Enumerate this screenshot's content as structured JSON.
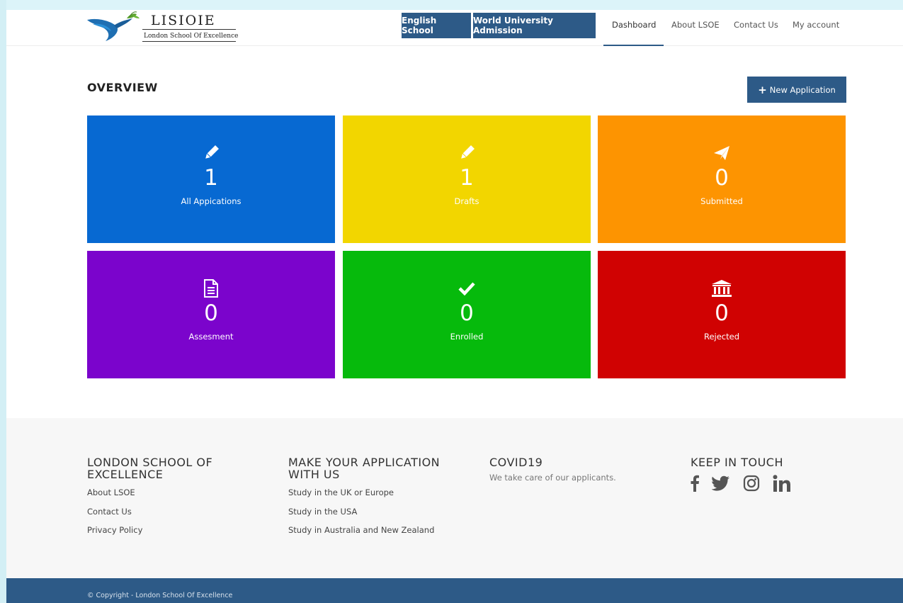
{
  "brand": {
    "name": "LISIOIE",
    "tagline": "London School Of Excellence"
  },
  "nav": {
    "buttons": [
      "English School",
      "World University Admission"
    ],
    "links": [
      "Dashboard",
      "About LSOE",
      "Contact Us",
      "My account"
    ],
    "active": "Dashboard"
  },
  "overview": {
    "title": "OVERVIEW",
    "new_button": "New Application",
    "tiles": [
      {
        "label": "All Appications",
        "count": "1",
        "icon": "pencil-icon",
        "color": "#0769d2"
      },
      {
        "label": "Drafts",
        "count": "1",
        "icon": "pencil-icon",
        "color": "#f2d600"
      },
      {
        "label": "Submitted",
        "count": "0",
        "icon": "paper-plane-icon",
        "color": "#fd9401"
      },
      {
        "label": "Assesment",
        "count": "0",
        "icon": "document-icon",
        "color": "#7b04cc"
      },
      {
        "label": "Enrolled",
        "count": "0",
        "icon": "checkmark-icon",
        "color": "#06ba0c"
      },
      {
        "label": "Rejected",
        "count": "0",
        "icon": "institution-icon",
        "color": "#d00202"
      }
    ]
  },
  "footer": {
    "col1": {
      "heading_line1": "LONDON SCHOOL OF",
      "heading_line2": "EXCELLENCE",
      "links": [
        "About LSOE",
        "Contact Us",
        "Privacy Policy"
      ]
    },
    "col2": {
      "heading_line1": "MAKE YOUR APPLICATION",
      "heading_line2": "WITH US",
      "links": [
        "Study in the UK or Europe",
        "Study in the USA",
        "Study in Australia and New Zealand"
      ]
    },
    "col3": {
      "heading": "COVID19",
      "text": "We take care of our applicants."
    },
    "col4": {
      "heading": "KEEP IN TOUCH",
      "icons": [
        "facebook-icon",
        "twitter-icon",
        "instagram-icon",
        "linkedin-icon"
      ]
    },
    "copyright": "© Copyright - London School Of Excellence"
  },
  "colors": {
    "primary": "#2d5a87",
    "footer_bg": "#f7f7f7"
  }
}
